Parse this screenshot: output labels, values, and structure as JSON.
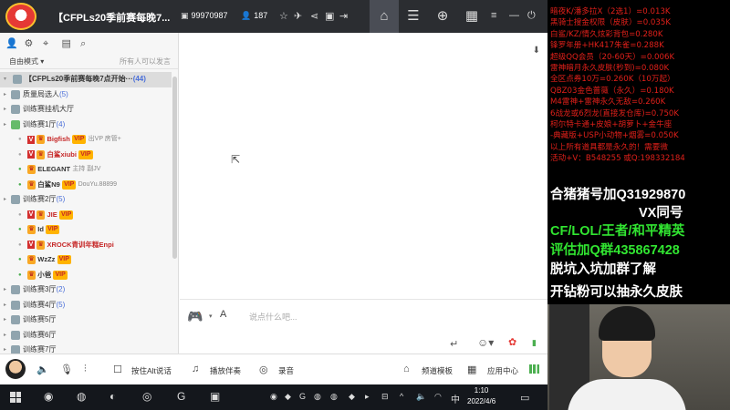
{
  "titlebar": {
    "title": "【CFPLs20季前赛每晚7...",
    "room_id": "99970987",
    "online_count": "187"
  },
  "left": {
    "mode_label": "自由模式",
    "speak_label": "所有人可以发言",
    "channels": [
      {
        "kind": "root",
        "label": "【CFPLs20季前赛每晚7点开始···",
        "count": "(44)",
        "selected": true
      },
      {
        "kind": "sub",
        "label": "质量局选人",
        "count": "(5)"
      },
      {
        "kind": "sub",
        "label": "训练赛挂机大厅",
        "count": ""
      },
      {
        "kind": "sub",
        "label": "训练赛1厅",
        "count": "(4)"
      },
      {
        "kind": "user",
        "v": true,
        "name": "Bigfish",
        "badge": "VIP",
        "tag": "出VP 房管+"
      },
      {
        "kind": "user",
        "v": true,
        "name": "白鲨xiubi",
        "badge": "VIP",
        "tag": ""
      },
      {
        "kind": "user",
        "v": false,
        "name": "ELEGANT",
        "badge": "",
        "tag": "主持 副JV"
      },
      {
        "kind": "user",
        "v": false,
        "name": "白鲨N9",
        "badge": "VIP",
        "tag": "DouYu.88899"
      },
      {
        "kind": "sub",
        "label": "训练赛2厅",
        "count": "(5)"
      },
      {
        "kind": "user",
        "v": true,
        "name": "JIE",
        "badge": "VIP",
        "tag": ""
      },
      {
        "kind": "user",
        "v": false,
        "name": "Id",
        "badge": "VIP",
        "tag": ""
      },
      {
        "kind": "user",
        "v": true,
        "name": "XROCK青训年糕Enpi",
        "badge": "",
        "tag": ""
      },
      {
        "kind": "user",
        "v": false,
        "name": "WzZz",
        "badge": "VIP",
        "tag": ""
      },
      {
        "kind": "user",
        "v": false,
        "name": "小爸",
        "badge": "VIP",
        "tag": ""
      },
      {
        "kind": "sub",
        "label": "训练赛3厅",
        "count": "(2)"
      },
      {
        "kind": "sub",
        "label": "训练赛4厅",
        "count": "(5)"
      },
      {
        "kind": "sub",
        "label": "训练赛5厅",
        "count": ""
      },
      {
        "kind": "sub",
        "label": "训练赛6厅",
        "count": ""
      },
      {
        "kind": "sub",
        "label": "训练赛7厅",
        "count": ""
      }
    ]
  },
  "chat": {
    "input_placeholder": "说点什么吧..."
  },
  "bottombar": {
    "hotkey_label": "按住Alt说话",
    "music_label": "播放伴奏",
    "record_label": "录音",
    "template_label": "频道模板",
    "app_center_label": "应用中心"
  },
  "taskbar": {
    "time": "1:10",
    "date": "2022/4/6",
    "ime": "中"
  },
  "overlay": {
    "price_lines": [
      "暗夜K/潘多拉X（2选1）=0.013K",
      "黑骑士搜金权限（皮肤）=0.035K",
      "白鲨/KZ/情久炫彩背包=0.280K",
      "锋罗年册+HK417朱雀=0.288K",
      "超级QQ会员（20-60天）=0.006K",
      "雷神暗月永久皮肤(秒到)=0.080K",
      "全区点券10万=0.260K（10万起）",
      "QBZ03金色蔷薇（永久）=0.180K",
      "M4雷神+雷神永久无敌=0.260K",
      "6战龙或6烈龙(直接发仓库)=0.750K",
      "柯尔特卡通+皮娘+胡萝卜+金牛座",
      "-典藏版+USP小动物+烟雾=0.050K",
      "以上所有道具都是永久的！需要微",
      "活动+V：B548255    或Q:198332184"
    ],
    "wechat_line": "合猪猪号加Q31929870",
    "vx_line": "VX同号",
    "green_line1": "CF/LOL/王者/和平精英",
    "green_line2": "评估加Q群435867428",
    "line_quit": "脱坑入坑加群了解",
    "line_diamond": "开钻粉可以抽永久皮肤"
  }
}
